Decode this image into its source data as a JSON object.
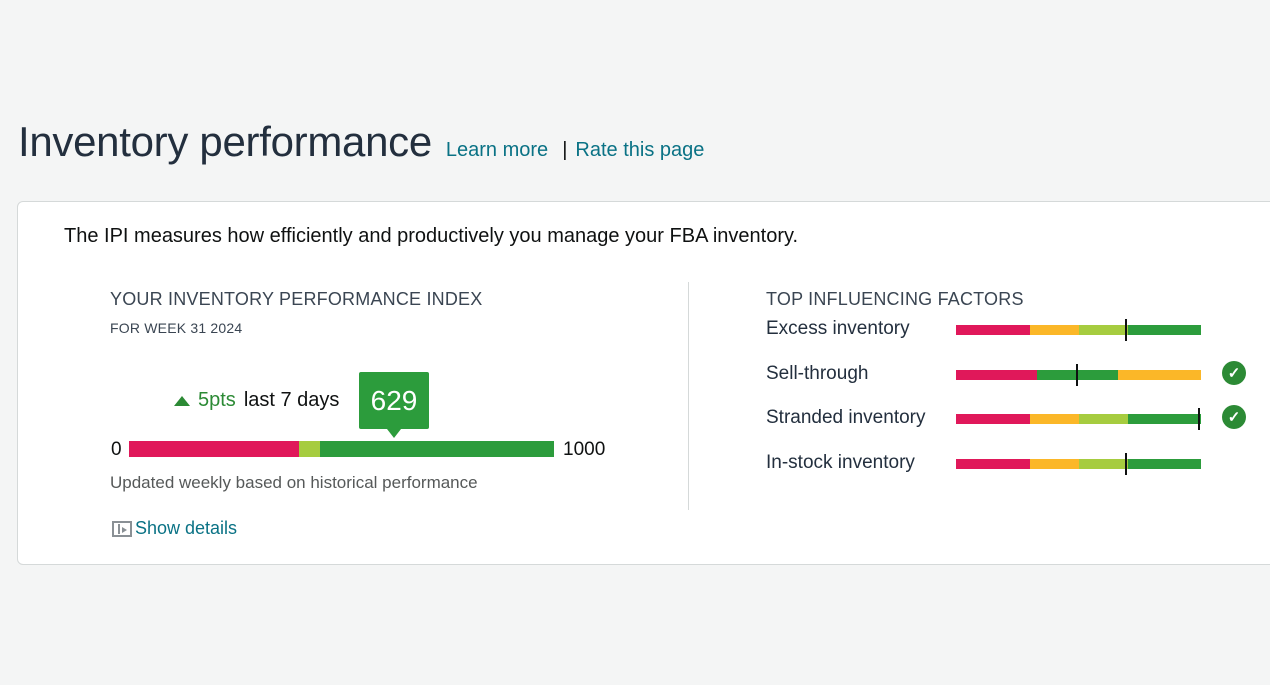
{
  "header": {
    "title": "Inventory performance",
    "learn_more": "Learn more",
    "separator": "|",
    "rate_page": "Rate this page"
  },
  "description": "The IPI measures how efficiently and productively you manage your FBA inventory.",
  "ipi": {
    "label": "YOUR INVENTORY PERFORMANCE INDEX",
    "week": "FOR WEEK 31 2024",
    "change": "5pts",
    "change_period": "last 7 days",
    "score": "629",
    "score_value": 629,
    "min": "0",
    "max": "1000",
    "updated": "Updated weekly based on historical performance",
    "show_details": "Show details",
    "zones": [
      {
        "color": "#e0185a",
        "from": 0,
        "to": 400
      },
      {
        "color": "#a6cc3f",
        "from": 400,
        "to": 450
      },
      {
        "color": "#2c9c3c",
        "from": 450,
        "to": 1000
      }
    ]
  },
  "factors": {
    "label": "TOP INFLUENCING FACTORS",
    "items": [
      {
        "name": "Excess inventory",
        "marker": 0.695,
        "check": false,
        "segments": [
          {
            "color": "#e0185a",
            "fraction": 0.3
          },
          {
            "color": "#fbb728",
            "fraction": 0.2
          },
          {
            "color": "#a6cc3f",
            "fraction": 0.2
          },
          {
            "color": "#2c9c3c",
            "fraction": 0.3
          }
        ]
      },
      {
        "name": "Sell-through",
        "marker": 0.495,
        "check": true,
        "segments": [
          {
            "color": "#e0185a",
            "fraction": 0.33
          },
          {
            "color": "#2c9c3c",
            "fraction": 0.33
          },
          {
            "color": "#fbb728",
            "fraction": 0.34
          }
        ]
      },
      {
        "name": "Stranded inventory",
        "marker": 0.99,
        "check": true,
        "segments": [
          {
            "color": "#e0185a",
            "fraction": 0.3
          },
          {
            "color": "#fbb728",
            "fraction": 0.2
          },
          {
            "color": "#a6cc3f",
            "fraction": 0.2
          },
          {
            "color": "#2c9c3c",
            "fraction": 0.3
          }
        ]
      },
      {
        "name": "In-stock inventory",
        "marker": 0.695,
        "check": false,
        "segments": [
          {
            "color": "#e0185a",
            "fraction": 0.3
          },
          {
            "color": "#fbb728",
            "fraction": 0.2
          },
          {
            "color": "#a6cc3f",
            "fraction": 0.2
          },
          {
            "color": "#2c9c3c",
            "fraction": 0.3
          }
        ]
      }
    ],
    "check_icon": "checkmark-circle-icon"
  }
}
